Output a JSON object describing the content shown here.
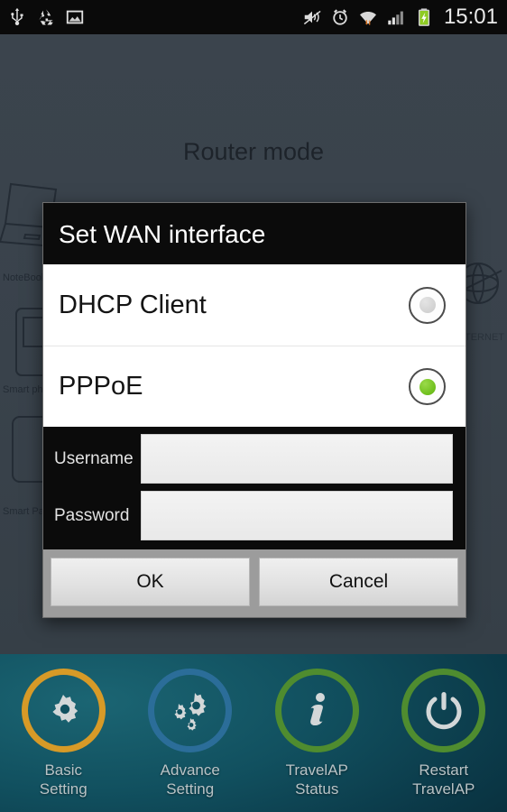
{
  "statusbar": {
    "time": "15:01",
    "left_icons": [
      "usb-icon",
      "recycle-icon",
      "gallery-icon"
    ],
    "right_icons": [
      "mute-icon",
      "alarm-icon",
      "wifi-icon",
      "signal-icon",
      "battery-charging-icon"
    ]
  },
  "background": {
    "title": "Router mode",
    "labels": {
      "notebook": "NoteBook",
      "smartphone": "Smart phone",
      "smartpad": "Smart Pad",
      "internet": "INTERNET"
    }
  },
  "dialog": {
    "title": "Set WAN interface",
    "options": [
      {
        "label": "DHCP Client",
        "selected": false
      },
      {
        "label": "PPPoE",
        "selected": true
      }
    ],
    "fields": [
      {
        "label": "Username",
        "value": "",
        "placeholder": ""
      },
      {
        "label": "Password",
        "value": "",
        "placeholder": ""
      }
    ],
    "buttons": {
      "ok": "OK",
      "cancel": "Cancel"
    }
  },
  "bottombar": {
    "items": [
      {
        "label_line1": "Basic",
        "label_line2": "Setting",
        "icon": "gear-icon",
        "ring_color": "#d79a27"
      },
      {
        "label_line1": "Advance",
        "label_line2": "Setting",
        "icon": "gears-icon",
        "ring_color": "#2b6d99"
      },
      {
        "label_line1": "TravelAP",
        "label_line2": "Status",
        "icon": "info-icon",
        "ring_color": "#4f8c2f"
      },
      {
        "label_line1": "Restart",
        "label_line2": "TravelAP",
        "icon": "power-icon",
        "ring_color": "#4f8c2f"
      }
    ]
  },
  "colors": {
    "accent_green": "#6fbf1c",
    "dialog_header_bg": "#0b0b0b",
    "bottombar_bg": "#0b3948"
  }
}
